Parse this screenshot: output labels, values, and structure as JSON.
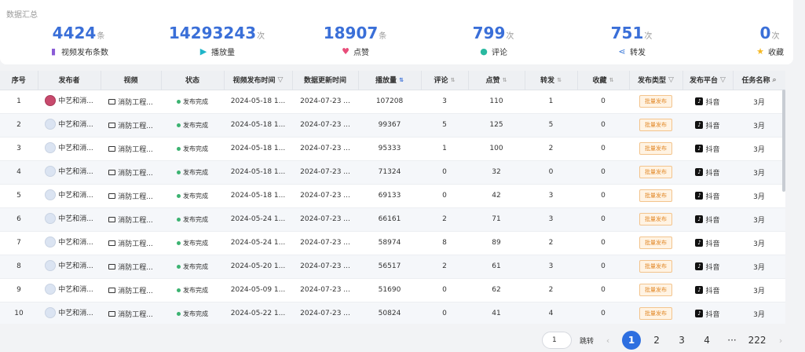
{
  "summary": {
    "title": "数据汇总",
    "stats": [
      {
        "value": "4424",
        "unit": "条",
        "label": "视频发布条数",
        "icon": "video-list-icon",
        "color": "#8a5cd6"
      },
      {
        "value": "14293243",
        "unit": "次",
        "label": "播放量",
        "icon": "play-icon",
        "color": "#1fb5c9"
      },
      {
        "value": "18907",
        "unit": "条",
        "label": "点赞",
        "icon": "heart-icon",
        "color": "#e84d7a"
      },
      {
        "value": "799",
        "unit": "次",
        "label": "评论",
        "icon": "comment-icon",
        "color": "#2ab9a0"
      },
      {
        "value": "751",
        "unit": "次",
        "label": "转发",
        "icon": "share-icon",
        "color": "#3a78d8"
      },
      {
        "value": "0",
        "unit": "次",
        "label": "收藏",
        "icon": "star-icon",
        "color": "#f5b823"
      }
    ]
  },
  "table": {
    "headers": {
      "index": "序号",
      "publisher": "发布者",
      "video": "视频",
      "status": "状态",
      "publish_time": "视频发布时间",
      "update_time": "数据更新时间",
      "plays": "播放量",
      "comments": "评论",
      "likes": "点赞",
      "shares": "转发",
      "favorites": "收藏",
      "publish_type": "发布类型",
      "platform": "发布平台",
      "task_name": "任务名称"
    },
    "rows": [
      {
        "index": "1",
        "publisher": "中艺和消...",
        "video": "消防工程...",
        "status": "发布完成",
        "publish_time": "2024-05-18 1...",
        "update_time": "2024-07-23 ...",
        "plays": "107208",
        "comments": "3",
        "likes": "110",
        "shares": "1",
        "favorites": "0",
        "publish_type": "批量发布",
        "platform": "抖音",
        "task_name": "3月"
      },
      {
        "index": "2",
        "publisher": "中艺和消...",
        "video": "消防工程...",
        "status": "发布完成",
        "publish_time": "2024-05-18 1...",
        "update_time": "2024-07-23 ...",
        "plays": "99367",
        "comments": "5",
        "likes": "125",
        "shares": "5",
        "favorites": "0",
        "publish_type": "批量发布",
        "platform": "抖音",
        "task_name": "3月"
      },
      {
        "index": "3",
        "publisher": "中艺和消...",
        "video": "消防工程...",
        "status": "发布完成",
        "publish_time": "2024-05-18 1...",
        "update_time": "2024-07-23 ...",
        "plays": "95333",
        "comments": "1",
        "likes": "100",
        "shares": "2",
        "favorites": "0",
        "publish_type": "批量发布",
        "platform": "抖音",
        "task_name": "3月"
      },
      {
        "index": "4",
        "publisher": "中艺和消...",
        "video": "消防工程...",
        "status": "发布完成",
        "publish_time": "2024-05-18 1...",
        "update_time": "2024-07-23 ...",
        "plays": "71324",
        "comments": "0",
        "likes": "32",
        "shares": "0",
        "favorites": "0",
        "publish_type": "批量发布",
        "platform": "抖音",
        "task_name": "3月"
      },
      {
        "index": "5",
        "publisher": "中艺和消...",
        "video": "消防工程...",
        "status": "发布完成",
        "publish_time": "2024-05-18 1...",
        "update_time": "2024-07-23 ...",
        "plays": "69133",
        "comments": "0",
        "likes": "42",
        "shares": "3",
        "favorites": "0",
        "publish_type": "批量发布",
        "platform": "抖音",
        "task_name": "3月"
      },
      {
        "index": "6",
        "publisher": "中艺和消...",
        "video": "消防工程...",
        "status": "发布完成",
        "publish_time": "2024-05-24 1...",
        "update_time": "2024-07-23 ...",
        "plays": "66161",
        "comments": "2",
        "likes": "71",
        "shares": "3",
        "favorites": "0",
        "publish_type": "批量发布",
        "platform": "抖音",
        "task_name": "3月"
      },
      {
        "index": "7",
        "publisher": "中艺和消...",
        "video": "消防工程...",
        "status": "发布完成",
        "publish_time": "2024-05-24 1...",
        "update_time": "2024-07-23 ...",
        "plays": "58974",
        "comments": "8",
        "likes": "89",
        "shares": "2",
        "favorites": "0",
        "publish_type": "批量发布",
        "platform": "抖音",
        "task_name": "3月"
      },
      {
        "index": "8",
        "publisher": "中艺和消...",
        "video": "消防工程...",
        "status": "发布完成",
        "publish_time": "2024-05-20 1...",
        "update_time": "2024-07-23 ...",
        "plays": "56517",
        "comments": "2",
        "likes": "61",
        "shares": "3",
        "favorites": "0",
        "publish_type": "批量发布",
        "platform": "抖音",
        "task_name": "3月"
      },
      {
        "index": "9",
        "publisher": "中艺和消...",
        "video": "消防工程...",
        "status": "发布完成",
        "publish_time": "2024-05-09 1...",
        "update_time": "2024-07-23 ...",
        "plays": "51690",
        "comments": "0",
        "likes": "62",
        "shares": "2",
        "favorites": "0",
        "publish_type": "批量发布",
        "platform": "抖音",
        "task_name": "3月"
      },
      {
        "index": "10",
        "publisher": "中艺和消...",
        "video": "消防工程...",
        "status": "发布完成",
        "publish_time": "2024-05-22 1...",
        "update_time": "2024-07-23 ...",
        "plays": "50824",
        "comments": "0",
        "likes": "41",
        "shares": "4",
        "favorites": "0",
        "publish_type": "批量发布",
        "platform": "抖音",
        "task_name": "3月"
      }
    ]
  },
  "pagination": {
    "jump_value": "1",
    "jump_label": "跳转",
    "prev_icon": "chevron-left-icon",
    "next_icon": "chevron-right-icon",
    "pages": [
      "1",
      "2",
      "3",
      "4",
      "···",
      "222"
    ],
    "current": "1"
  }
}
